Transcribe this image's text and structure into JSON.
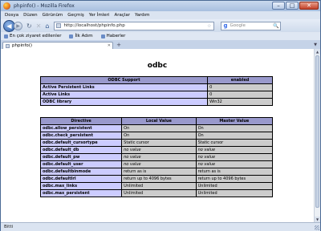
{
  "window": {
    "title": "phpinfo() - Mozilla Firefox",
    "controls": {
      "minimize": "–",
      "maximize": "□",
      "close": "✕"
    }
  },
  "menu": [
    "Dosya",
    "Düzen",
    "Görünüm",
    "Geçmiş",
    "Yer İmleri",
    "Araçlar",
    "Yardım"
  ],
  "nav": {
    "back_glyph": "◀",
    "forward_glyph": "▶",
    "reload_glyph": "↻",
    "stop_glyph": "✕",
    "home_glyph": "⌂",
    "url": "http://localhost/phpinfo.php",
    "star_glyph": "☆",
    "search_logo": "g",
    "search_placeholder": "Google",
    "search_go_glyph": "🔍"
  },
  "bookmarks": [
    "En çok ziyaret edilenler",
    "İlk Adım",
    "Haberler"
  ],
  "tab": {
    "label": "phpinfo()",
    "close_glyph": "✕",
    "new_glyph": "+",
    "list_glyph": "▼"
  },
  "page": {
    "title": "odbc",
    "support_table": {
      "headers": [
        "ODBC Support",
        "enabled"
      ],
      "rows": [
        {
          "key": "Active Persistent Links",
          "value": "0"
        },
        {
          "key": "Active Links",
          "value": "0"
        },
        {
          "key": "ODBC library",
          "value": "Win32"
        }
      ]
    },
    "directive_table": {
      "headers": [
        "Directive",
        "Local Value",
        "Master Value"
      ],
      "rows": [
        {
          "directive": "odbc.allow_persistent",
          "local": "On",
          "master": "On",
          "italic": false
        },
        {
          "directive": "odbc.check_persistent",
          "local": "On",
          "master": "On",
          "italic": false
        },
        {
          "directive": "odbc.default_cursortype",
          "local": "Static cursor",
          "master": "Static cursor",
          "italic": false
        },
        {
          "directive": "odbc.default_db",
          "local": "no value",
          "master": "no value",
          "italic": true
        },
        {
          "directive": "odbc.default_pw",
          "local": "no value",
          "master": "no value",
          "italic": true
        },
        {
          "directive": "odbc.default_user",
          "local": "no value",
          "master": "no value",
          "italic": true
        },
        {
          "directive": "odbc.defaultbinmode",
          "local": "return as is",
          "master": "return as is",
          "italic": false
        },
        {
          "directive": "odbc.defaultlrl",
          "local": "return up to 4096 bytes",
          "master": "return up to 4096 bytes",
          "italic": false
        },
        {
          "directive": "odbc.max_links",
          "local": "Unlimited",
          "master": "Unlimited",
          "italic": false
        },
        {
          "directive": "odbc.max_persistent",
          "local": "Unlimited",
          "master": "Unlimited",
          "italic": false
        }
      ]
    }
  },
  "status": {
    "text": "Bitti"
  }
}
